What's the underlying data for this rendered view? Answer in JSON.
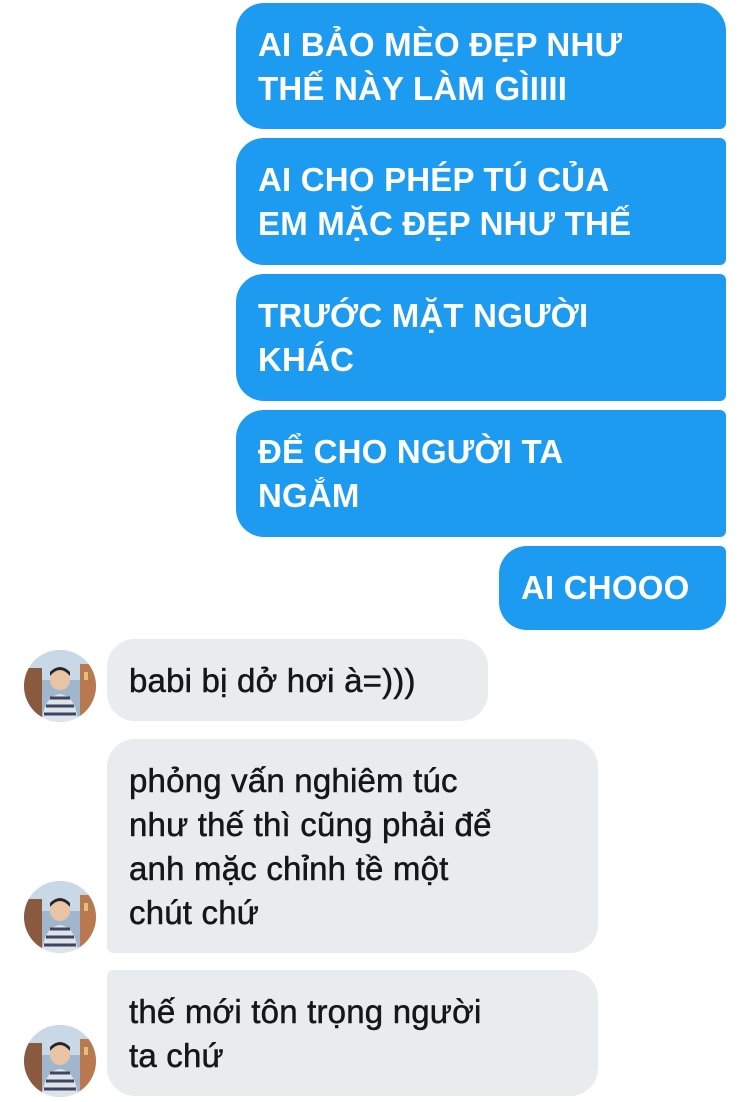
{
  "conversation": {
    "outgoing": [
      {
        "text": "AI BẢO MÈO ĐẸP NHƯ\nTHẾ NÀY LÀM GÌIIII"
      },
      {
        "text": "AI CHO PHÉP TÚ CỦA\nEM MẶC ĐẸP NHƯ THẾ"
      },
      {
        "text": "TRƯỚC MẶT NGƯỜI\nKHÁC"
      },
      {
        "text": "ĐỂ CHO NGƯỜI TA\nNGẮM"
      },
      {
        "text": "AI CHOOO"
      }
    ],
    "incoming": [
      {
        "text": "babi bị dở hơi à=)))"
      },
      {
        "text": "phỏng vấn nghiêm túc\nnhư thế thì cũng phải để\nanh mặc chỉnh tề một\nchút chứ"
      },
      {
        "text": "thế mới tôn trọng người\nta chứ"
      }
    ]
  },
  "colors": {
    "outgoing_bubble": "#1d9bf0",
    "incoming_bubble": "#e9ecef",
    "outgoing_text": "#ffffff",
    "incoming_text": "#14171a"
  }
}
